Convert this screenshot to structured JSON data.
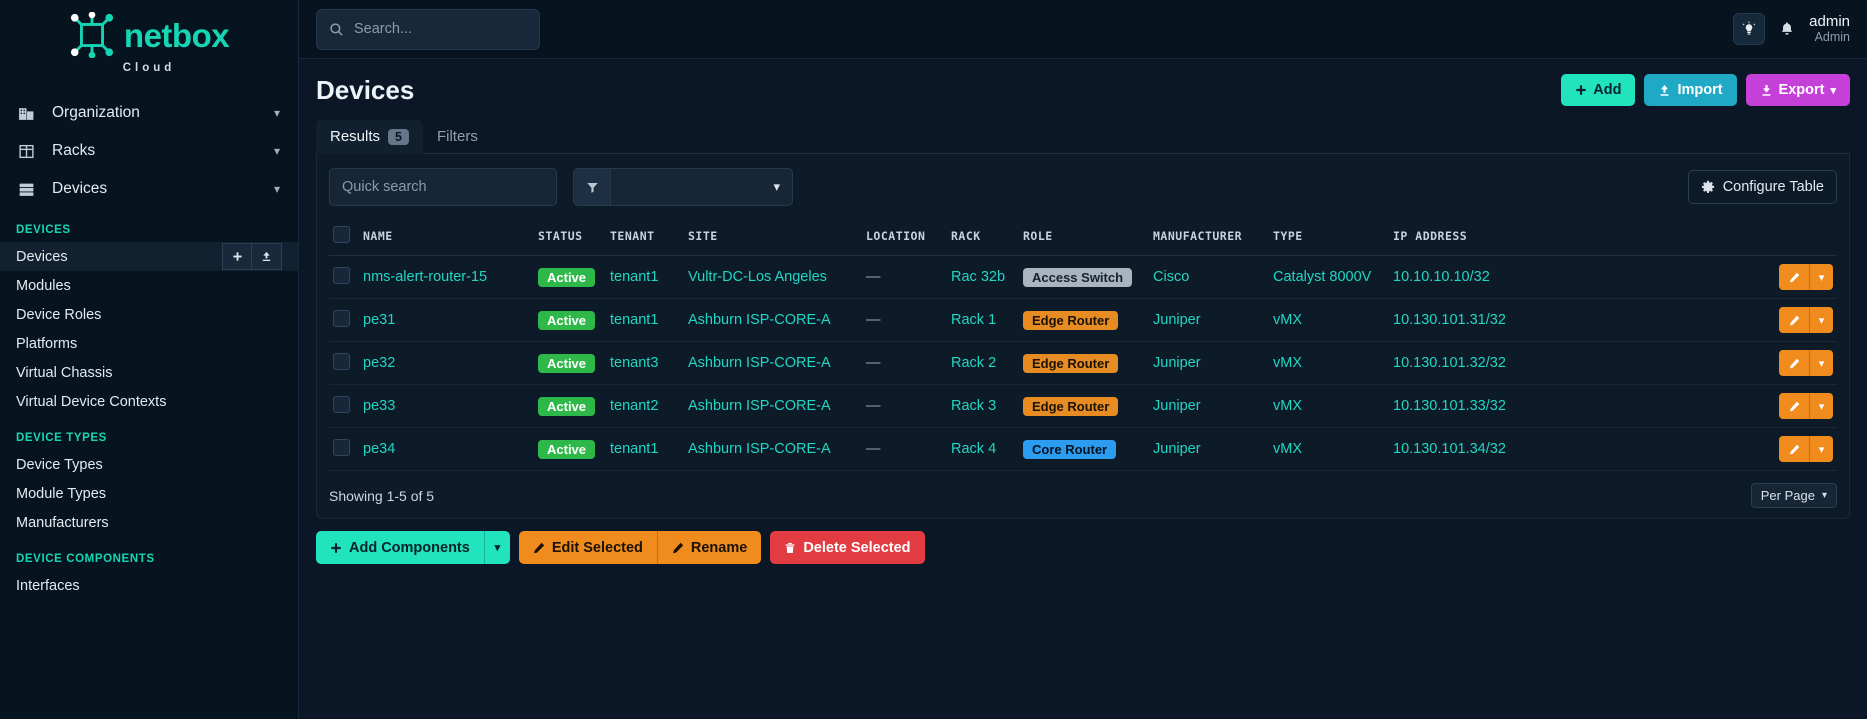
{
  "brand": {
    "name": "netbox",
    "sub": "Cloud",
    "logo_icon": "netbox-logo-icon",
    "accent": "#16d5b5"
  },
  "topbar": {
    "search_placeholder": "Search...",
    "search_icon": "search-icon",
    "theme_icon": "lightbulb-icon",
    "bell_icon": "bell-icon",
    "user_name": "admin",
    "user_role": "Admin"
  },
  "sidebar": {
    "nav": [
      {
        "label": "Organization",
        "icon": "building-icon",
        "chevron": "chevron-down-icon"
      },
      {
        "label": "Racks",
        "icon": "rack-icon",
        "chevron": "chevron-down-icon"
      },
      {
        "label": "Devices",
        "icon": "server-icon",
        "chevron": "chevron-down-icon"
      }
    ],
    "sections": [
      {
        "title": "DEVICES",
        "items": [
          {
            "label": "Devices",
            "active": true,
            "add_icon": "plus-icon",
            "import_icon": "upload-icon"
          },
          {
            "label": "Modules",
            "active": false
          },
          {
            "label": "Device Roles",
            "active": false
          },
          {
            "label": "Platforms",
            "active": false
          },
          {
            "label": "Virtual Chassis",
            "active": false
          },
          {
            "label": "Virtual Device Contexts",
            "active": false
          }
        ]
      },
      {
        "title": "DEVICE TYPES",
        "items": [
          {
            "label": "Device Types",
            "active": false
          },
          {
            "label": "Module Types",
            "active": false
          },
          {
            "label": "Manufacturers",
            "active": false
          }
        ]
      },
      {
        "title": "DEVICE COMPONENTS",
        "items": [
          {
            "label": "Interfaces",
            "active": false
          }
        ]
      }
    ]
  },
  "page": {
    "title": "Devices",
    "actions": [
      {
        "label": "Add",
        "icon": "plus-icon",
        "color": "#21e3bd"
      },
      {
        "label": "Import",
        "icon": "upload-icon",
        "color": "#1fa9c4"
      },
      {
        "label": "Export",
        "icon": "download-icon",
        "color": "#c440d8",
        "caret": "chevron-down-icon"
      }
    ],
    "tabs": [
      {
        "label": "Results",
        "count": "5",
        "active": true
      },
      {
        "label": "Filters",
        "count": "",
        "active": false
      }
    ]
  },
  "toolbar": {
    "quick_search_placeholder": "Quick search",
    "filter_icon": "funnel-icon",
    "filter_value": "",
    "filter_caret": "chevron-down-icon",
    "configure_label": "Configure Table",
    "configure_icon": "gear-icon"
  },
  "table": {
    "columns": [
      "NAME",
      "STATUS",
      "TENANT",
      "SITE",
      "LOCATION",
      "RACK",
      "ROLE",
      "MANUFACTURER",
      "TYPE",
      "IP ADDRESS"
    ],
    "rows": [
      {
        "name": "nms-alert-router-15",
        "status": "Active",
        "status_style": "b-green",
        "tenant": "tenant1",
        "site": "Vultr-DC-Los Angeles",
        "location": "—",
        "rack": "Rac 32b",
        "role": "Access Switch",
        "role_style": "b-grey",
        "manufacturer": "Cisco",
        "type": "Catalyst 8000V",
        "ip": "10.10.10.10/32"
      },
      {
        "name": "pe31",
        "status": "Active",
        "status_style": "b-green",
        "tenant": "tenant1",
        "site": "Ashburn ISP-CORE-A",
        "location": "—",
        "rack": "Rack 1",
        "role": "Edge Router",
        "role_style": "b-orange",
        "manufacturer": "Juniper",
        "type": "vMX",
        "ip": "10.130.101.31/32"
      },
      {
        "name": "pe32",
        "status": "Active",
        "status_style": "b-green",
        "tenant": "tenant3",
        "site": "Ashburn ISP-CORE-A",
        "location": "—",
        "rack": "Rack 2",
        "role": "Edge Router",
        "role_style": "b-orange",
        "manufacturer": "Juniper",
        "type": "vMX",
        "ip": "10.130.101.32/32"
      },
      {
        "name": "pe33",
        "status": "Active",
        "status_style": "b-green",
        "tenant": "tenant2",
        "site": "Ashburn ISP-CORE-A",
        "location": "—",
        "rack": "Rack 3",
        "role": "Edge Router",
        "role_style": "b-orange",
        "manufacturer": "Juniper",
        "type": "vMX",
        "ip": "10.130.101.33/32"
      },
      {
        "name": "pe34",
        "status": "Active",
        "status_style": "b-green",
        "tenant": "tenant1",
        "site": "Ashburn ISP-CORE-A",
        "location": "—",
        "rack": "Rack 4",
        "role": "Core Router",
        "role_style": "b-blue",
        "manufacturer": "Juniper",
        "type": "vMX",
        "ip": "10.130.101.34/32"
      }
    ],
    "row_action_icon": "pencil-icon",
    "row_action_caret": "chevron-down-icon"
  },
  "footer": {
    "showing": "Showing 1-5 of 5",
    "per_page_label": "Per Page",
    "per_page_caret": "chevron-down-icon"
  },
  "bulk": {
    "add_components": "Add Components",
    "add_components_icon": "plus-icon",
    "add_components_caret": "chevron-down-icon",
    "edit_selected": "Edit Selected",
    "edit_icon": "pencil-icon",
    "rename": "Rename",
    "rename_icon": "pencil-icon",
    "delete_selected": "Delete Selected",
    "delete_icon": "trash-icon"
  }
}
